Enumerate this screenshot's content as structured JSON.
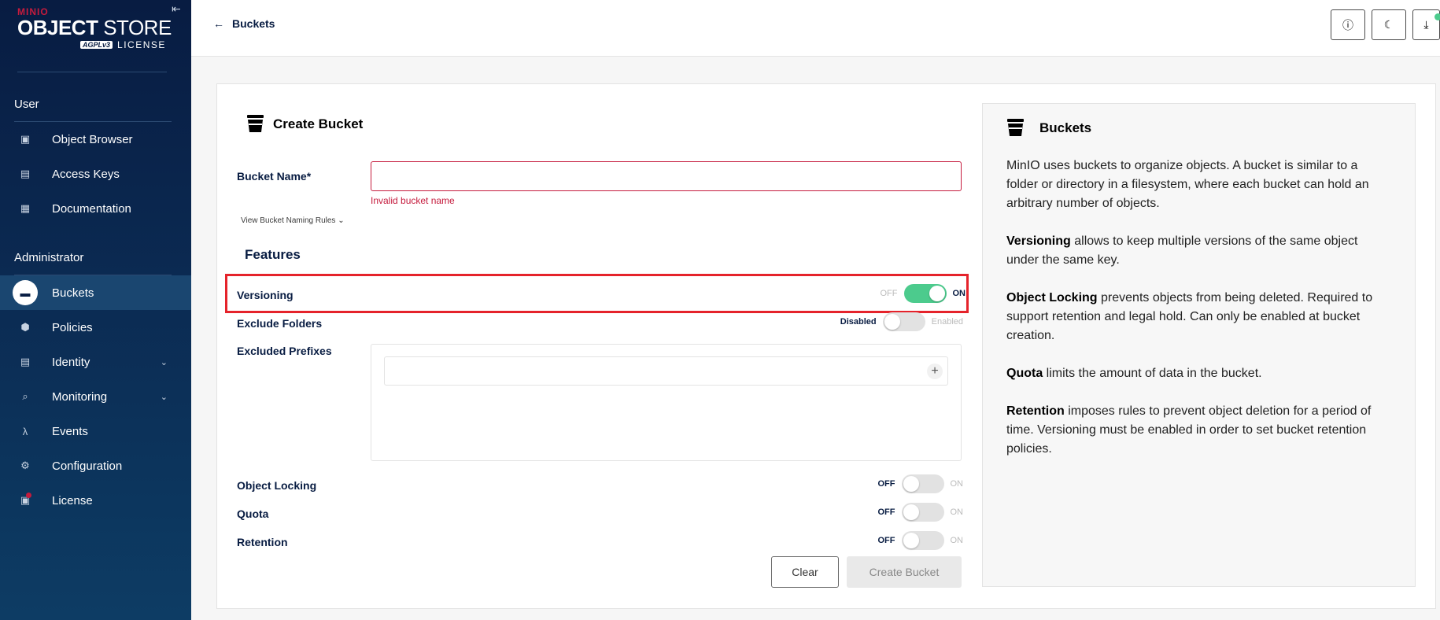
{
  "brand": {
    "minio": "MINIO",
    "store_bold": "OBJECT",
    "store_light": "STORE",
    "agpl": "AGPLv3",
    "license": "LICENSE"
  },
  "sidebar": {
    "user_section": "User",
    "user_items": [
      {
        "label": "Object Browser",
        "icon": "object-browser-icon"
      },
      {
        "label": "Access Keys",
        "icon": "access-keys-icon"
      },
      {
        "label": "Documentation",
        "icon": "documentation-icon"
      }
    ],
    "admin_section": "Administrator",
    "admin_items": [
      {
        "label": "Buckets",
        "icon": "bucket-icon",
        "active": true
      },
      {
        "label": "Policies",
        "icon": "policies-icon"
      },
      {
        "label": "Identity",
        "icon": "identity-icon",
        "expandable": true
      },
      {
        "label": "Monitoring",
        "icon": "monitoring-icon",
        "expandable": true
      },
      {
        "label": "Events",
        "icon": "lambda-icon"
      },
      {
        "label": "Configuration",
        "icon": "gear-icon"
      },
      {
        "label": "License",
        "icon": "license-icon",
        "badge": true
      }
    ]
  },
  "header": {
    "back_label": "Buckets",
    "buttons": [
      "help-icon",
      "dark-mode-icon",
      "download-icon"
    ]
  },
  "form": {
    "title": "Create Bucket",
    "bucket_name_label": "Bucket Name*",
    "bucket_name_value": "",
    "error": "Invalid bucket name",
    "naming_rules_link": "View Bucket Naming Rules",
    "features_title": "Features",
    "versioning": {
      "label": "Versioning",
      "off": "OFF",
      "on": "ON",
      "enabled": true
    },
    "exclude_folders": {
      "label": "Exclude Folders",
      "off": "Disabled",
      "on": "Enabled",
      "enabled": false
    },
    "excluded_prefixes_label": "Excluded Prefixes",
    "object_locking": {
      "label": "Object Locking",
      "off": "OFF",
      "on": "ON",
      "enabled": false
    },
    "quota": {
      "label": "Quota",
      "off": "OFF",
      "on": "ON",
      "enabled": false
    },
    "retention": {
      "label": "Retention",
      "off": "OFF",
      "on": "ON",
      "enabled": false
    },
    "clear_label": "Clear",
    "create_label": "Create Bucket"
  },
  "help": {
    "title": "Buckets",
    "intro": "MinIO uses buckets to organize objects. A bucket is similar to a folder or directory in a filesystem, where each bucket can hold an arbitrary number of objects.",
    "versioning_term": "Versioning",
    "versioning_text": " allows to keep multiple versions of the same object under the same key.",
    "locking_term": "Object Locking",
    "locking_text": " prevents objects from being deleted. Required to support retention and legal hold. Can only be enabled at bucket creation.",
    "quota_term": "Quota",
    "quota_text": " limits the amount of data in the bucket.",
    "retention_term": "Retention",
    "retention_text": " imposes rules to prevent object deletion for a period of time. Versioning must be enabled in order to set bucket retention policies."
  },
  "colors": {
    "sidebar_bg": "#081c42",
    "accent_green": "#4ccb8d",
    "error_red": "#c51b3d",
    "highlight_red": "#e5232b"
  }
}
